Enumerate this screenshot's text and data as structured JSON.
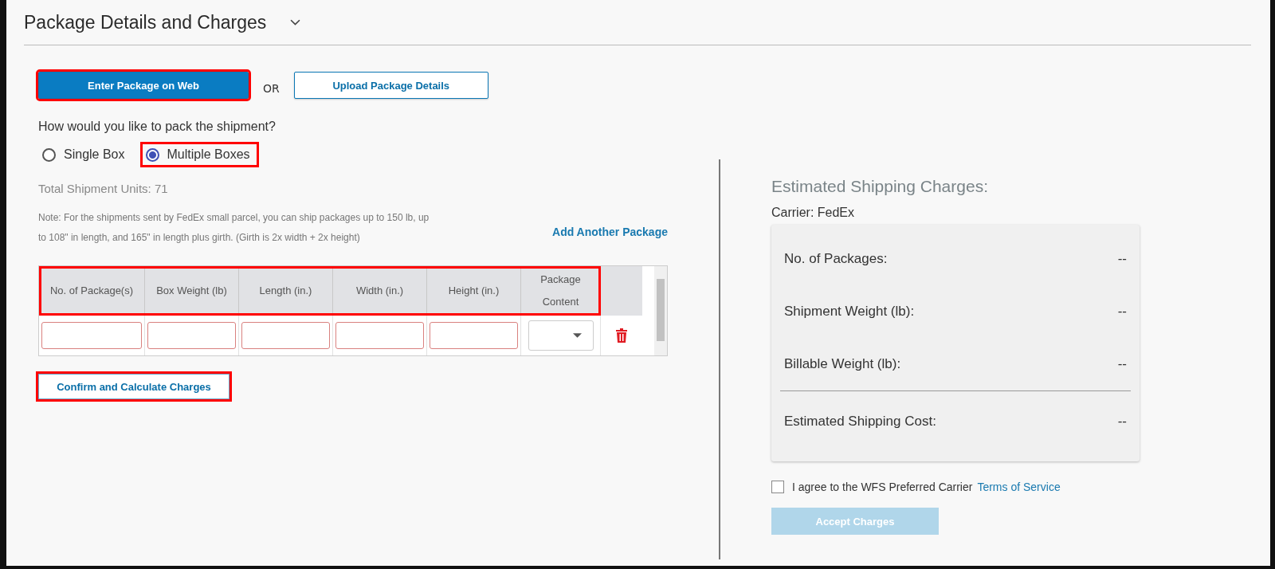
{
  "section": {
    "title": "Package Details and Charges",
    "expanded": true
  },
  "entry_modes": [
    {
      "label": "Enter Package on Web",
      "selected": true,
      "highlighted": true
    },
    {
      "label": "Upload Package Details",
      "selected": false,
      "highlighted": false
    }
  ],
  "or_label": "OR",
  "pack_question": "How would you like to pack the shipment?",
  "pack_options": [
    {
      "label": "Single Box",
      "selected": false,
      "highlighted": false
    },
    {
      "label": "Multiple Boxes",
      "selected": true,
      "highlighted": true
    }
  ],
  "total_units": "Total Shipment Units: 71",
  "note": "Note: For the shipments sent by FedEx small parcel, you can ship packages up to 150 lb, up to 108\" in length, and 165\" in length plus girth. (Girth is 2x width + 2x height)",
  "add_package_link": "Add Another Package",
  "table": {
    "header_highlighted": true,
    "columns": [
      "No. of Package(s)",
      "Box Weight (lb)",
      "Length (in.)",
      "Width (in.)",
      "Height (in.)",
      "Package Content"
    ],
    "rows": [
      {
        "cells": [
          {
            "kind": "input"
          },
          {
            "kind": "input"
          },
          {
            "kind": "input"
          },
          {
            "kind": "input"
          },
          {
            "kind": "input"
          },
          {
            "kind": "select"
          }
        ]
      }
    ]
  },
  "confirm_button": {
    "label": "Confirm and Calculate Charges",
    "highlighted": true
  },
  "charges": {
    "title": "Estimated Shipping Charges:",
    "carrier": "Carrier: FedEx",
    "rows": [
      {
        "label": "No. of Packages:",
        "value": "--"
      },
      {
        "label": "Shipment Weight (lb):",
        "value": "--"
      },
      {
        "label": "Billable Weight (lb):",
        "value": "--"
      }
    ],
    "total": {
      "label": "Estimated Shipping Cost:",
      "value": "--"
    }
  },
  "agreement": {
    "checked": false,
    "text": "I agree to the WFS Preferred Carrier",
    "link": "Terms of Service"
  },
  "accept_button": {
    "label": "Accept Charges",
    "disabled": true
  }
}
